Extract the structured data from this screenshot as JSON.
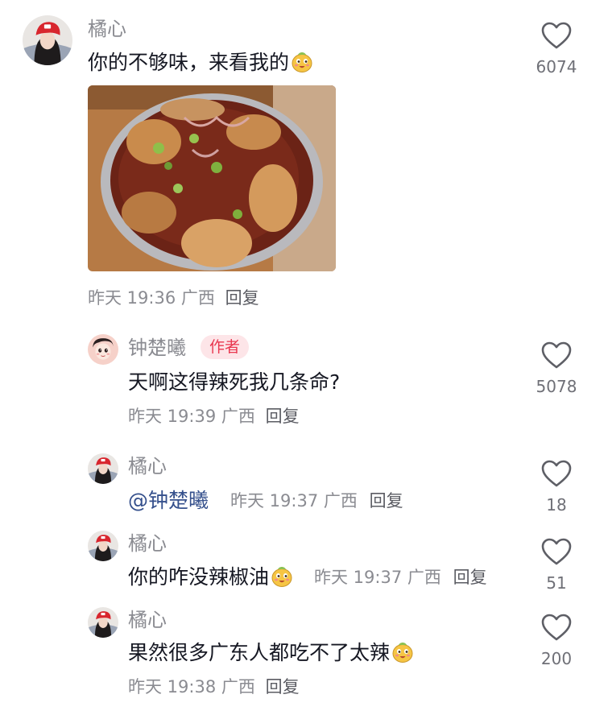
{
  "comments": [
    {
      "user": "橘心",
      "text": "你的不够味，来看我的",
      "text_emoji": "smile-face-emoji",
      "image": "hot-pot-photo",
      "time": "昨天 19:36",
      "location": "广西",
      "reply_label": "回复",
      "likes": "6074",
      "like_icon": "heart-outline-icon"
    }
  ],
  "replies": [
    {
      "user": "钟楚曦",
      "tag": "作者",
      "text": "天啊这得辣死我几条命?",
      "time": "昨天 19:39",
      "location": "广西",
      "reply_label": "回复",
      "likes": "5078"
    },
    {
      "user": "橘心",
      "mention": "@钟楚曦",
      "time": "昨天 19:37",
      "location": "广西",
      "reply_label": "回复",
      "likes": "18"
    },
    {
      "user": "橘心",
      "text": "你的咋没辣椒油",
      "text_emoji": "smile-face-emoji",
      "time": "昨天 19:37",
      "location": "广西",
      "reply_label": "回复",
      "likes": "51"
    },
    {
      "user": "橘心",
      "text": "果然很多广东人都吃不了太辣",
      "text_emoji": "smile-face-emoji",
      "time": "昨天 19:38",
      "location": "广西",
      "reply_label": "回复",
      "likes": "200"
    }
  ],
  "colors": {
    "text": "#161823",
    "secondary": "#8a8b91",
    "mention": "#35508c",
    "author_tag_bg": "#fde5e8",
    "author_tag_text": "#e9374f"
  }
}
